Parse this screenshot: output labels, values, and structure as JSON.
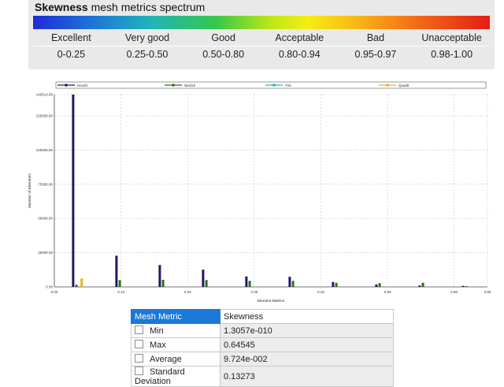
{
  "spectrum": {
    "title_bold": "Skewness",
    "title_rest": " mesh metrics spectrum",
    "categories": [
      "Excellent",
      "Very good",
      "Good",
      "Acceptable",
      "Bad",
      "Unacceptable"
    ],
    "ranges": [
      "0-0.25",
      "0.25-0.50",
      "0.50-0.80",
      "0.80-0.94",
      "0.95-0.97",
      "0.98-1.00"
    ]
  },
  "chart_data": {
    "type": "bar",
    "xlabel": "Element Metrics",
    "ylabel": "Number of Elements",
    "xlim": [
      0,
      0.65
    ],
    "ylim": [
      0,
      140514
    ],
    "x_ticks": [
      "0.00",
      "0.10",
      "0.20",
      "0.30",
      "0.40",
      "0.50",
      "0.60",
      "0.65"
    ],
    "x_tick_values": [
      0,
      0.1,
      0.2,
      0.3,
      0.4,
      0.5,
      0.6,
      0.65
    ],
    "y_ticks": [
      "0.00",
      "25000.00",
      "50000.00",
      "75000.00",
      "100000.00",
      "125000.00",
      "140514.00"
    ],
    "y_tick_values": [
      0,
      25000,
      50000,
      75000,
      100000,
      125000,
      140514
    ],
    "grid": true,
    "legend_placement": "top",
    "bin_centers": [
      0.0325,
      0.0975,
      0.1625,
      0.2275,
      0.2925,
      0.3575,
      0.4225,
      0.4875,
      0.5525,
      0.6175
    ],
    "series": [
      {
        "name": "Hex20",
        "color": "#2a1460",
        "values": [
          140514,
          22800,
          16000,
          12600,
          7600,
          7400,
          3600,
          1800,
          1000,
          800
        ]
      },
      {
        "name": "Wed15",
        "color": "#2f6e1c",
        "values": [
          1600,
          5000,
          5200,
          5000,
          4400,
          4400,
          3000,
          2800,
          3000,
          600
        ]
      },
      {
        "name": "Tri6",
        "color": "#22b5c6",
        "values": [
          0,
          0,
          0,
          0,
          0,
          0,
          0,
          0,
          0,
          0
        ]
      },
      {
        "name": "Quad8",
        "color": "#e8b12a",
        "values": [
          6200,
          0,
          0,
          0,
          0,
          0,
          0,
          0,
          0,
          0
        ]
      }
    ]
  },
  "metric_table": {
    "header_label": "Mesh Metric",
    "header_value": "Skewness",
    "rows": [
      {
        "label": "Min",
        "value": "1.3057e-010"
      },
      {
        "label": "Max",
        "value": "0.64545"
      },
      {
        "label": "Average",
        "value": "9.724e-002"
      },
      {
        "label": "Standard Deviation",
        "value": "0.13273"
      }
    ]
  }
}
